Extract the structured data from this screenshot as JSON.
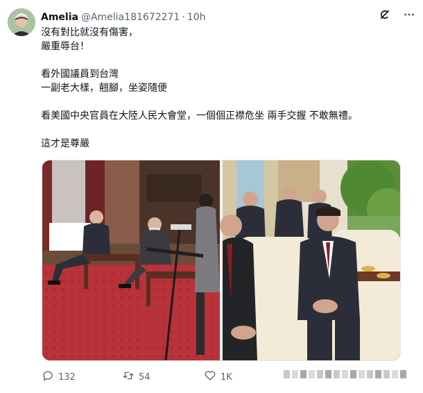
{
  "tweet": {
    "author_name": "Amelia",
    "author_handle": "@Amelia181672271",
    "separator": "·",
    "time": "10h",
    "text_lines": [
      "沒有對比就沒有傷害，",
      "嚴重辱台！",
      "",
      "看外國議員到台灣",
      "一副老大樣，翹腳，坐姿隨便",
      "",
      "看美國中央官員在大陸人民大會堂，一個個正襟危坐 兩手交握 不敢無禮。",
      "",
      "這才是尊嚴"
    ]
  },
  "header_icons": [
    "grok-icon",
    "more-icon"
  ],
  "media": {
    "left_image": "Taiwan meeting room photo",
    "right_image": "Great Hall of the People meeting photo"
  },
  "actions": {
    "replies": "132",
    "retweets": "54",
    "likes": "1K"
  },
  "colors": {
    "text": "#0f1419",
    "secondary": "#536471",
    "carpet": "#b8323a"
  }
}
